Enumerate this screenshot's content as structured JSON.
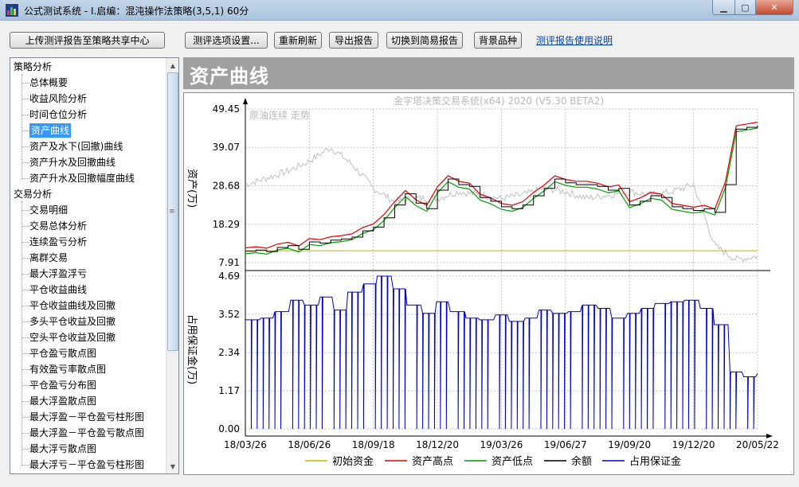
{
  "window": {
    "title": "公式测试系统 - I.启编：混沌操作法策略(3,5,1) 60分"
  },
  "toolbar": {
    "upload_label": "上传测评报告至策略共享中心",
    "options_label": "测评选项设置...",
    "refresh_label": "重新刷新",
    "export_label": "导出报告",
    "switch_label": "切换到简易报告",
    "background_label": "背景品种",
    "help_link": "测评报告使用说明"
  },
  "tree": {
    "groups": [
      {
        "label": "策略分析",
        "items": [
          "总体概要",
          "收益风险分析",
          "时间仓位分析",
          "资产曲线",
          "资产及水下(回撤)曲线",
          "资产升水及回撤曲线",
          "资产升水及回撤幅度曲线"
        ]
      },
      {
        "label": "交易分析",
        "items": [
          "交易明细",
          "交易总体分析",
          "连续盈亏分析",
          "离群交易",
          "最大浮盈浮亏",
          "平仓收益曲线",
          "平仓收益曲线及回撤",
          "多头平仓收益及回撤",
          "空头平仓收益及回撤",
          "平仓盈亏散点图",
          "有效盈亏率散点图",
          "平仓盈亏分布图",
          "最大浮盈散点图",
          "最大浮盈－平仓盈亏柱形图",
          "最大浮盈－平仓盈亏散点图",
          "最大浮亏散点图",
          "最大浮亏－平仓盈亏柱形图"
        ]
      }
    ],
    "selected": "资产曲线"
  },
  "panel": {
    "title": "资产曲线"
  },
  "colors": {
    "initial": "#c8b400",
    "high": "#e00000",
    "low": "#00a000",
    "balance": "#000000",
    "margin": "#0000c8",
    "background_series": "#c0c0c0"
  },
  "chart_data": {
    "type": "line",
    "watermark": "金字塔决策交易系统(x64) 2020 (V5.30 BETA2)",
    "background_label": "原油连续 走势",
    "x_ticks": [
      "18/03/26",
      "18/06/26",
      "18/09/18",
      "18/12/20",
      "19/03/26",
      "19/06/27",
      "19/09/20",
      "19/12/20",
      "20/05/22"
    ],
    "top_panel": {
      "ylabel": "资产(万)",
      "y_ticks": [
        "49.45",
        "39.07",
        "28.68",
        "18.29",
        "7.91"
      ],
      "ylim": [
        7.91,
        49.45
      ],
      "initial_capital": 11.1,
      "balance": [
        11.0,
        11.3,
        10.9,
        12.0,
        12.5,
        11.5,
        13.5,
        13.2,
        14.0,
        14.3,
        14.8,
        16.5,
        17.5,
        20.0,
        23.5,
        26.5,
        24.0,
        22.5,
        27.5,
        30.5,
        29.0,
        28.5,
        25.5,
        24.5,
        23.0,
        22.5,
        23.5,
        26.0,
        28.0,
        30.5,
        29.5,
        29.0,
        29.0,
        28.5,
        27.5,
        28.0,
        23.5,
        24.5,
        26.0,
        25.5,
        23.0,
        22.5,
        22.0,
        22.5,
        21.5,
        29.0,
        44.0,
        44.5,
        45.0
      ]
    },
    "bottom_panel": {
      "ylabel": "占用保证金(万)",
      "y_ticks": [
        "4.69",
        "3.52",
        "2.34",
        "1.17",
        "0.00"
      ],
      "ylim": [
        0.0,
        4.69
      ],
      "margin_levels": [
        3.35,
        3.4,
        3.6,
        3.95,
        3.8,
        4.05,
        3.65,
        4.2,
        4.45,
        4.69,
        4.3,
        3.8,
        3.55,
        3.9,
        3.6,
        3.4,
        3.35,
        3.5,
        3.3,
        3.4,
        3.65,
        3.55,
        3.6,
        3.8,
        3.7,
        3.4,
        3.55,
        3.7,
        3.85,
        3.9,
        3.95,
        3.7,
        3.2,
        1.75,
        1.6,
        1.7
      ]
    },
    "legend": [
      {
        "name": "初始资金",
        "color": "#c8b400"
      },
      {
        "name": "资产高点",
        "color": "#e00000"
      },
      {
        "name": "资产低点",
        "color": "#00a000"
      },
      {
        "name": "余额",
        "color": "#000000"
      },
      {
        "name": "占用保证金",
        "color": "#0000c8"
      }
    ]
  }
}
